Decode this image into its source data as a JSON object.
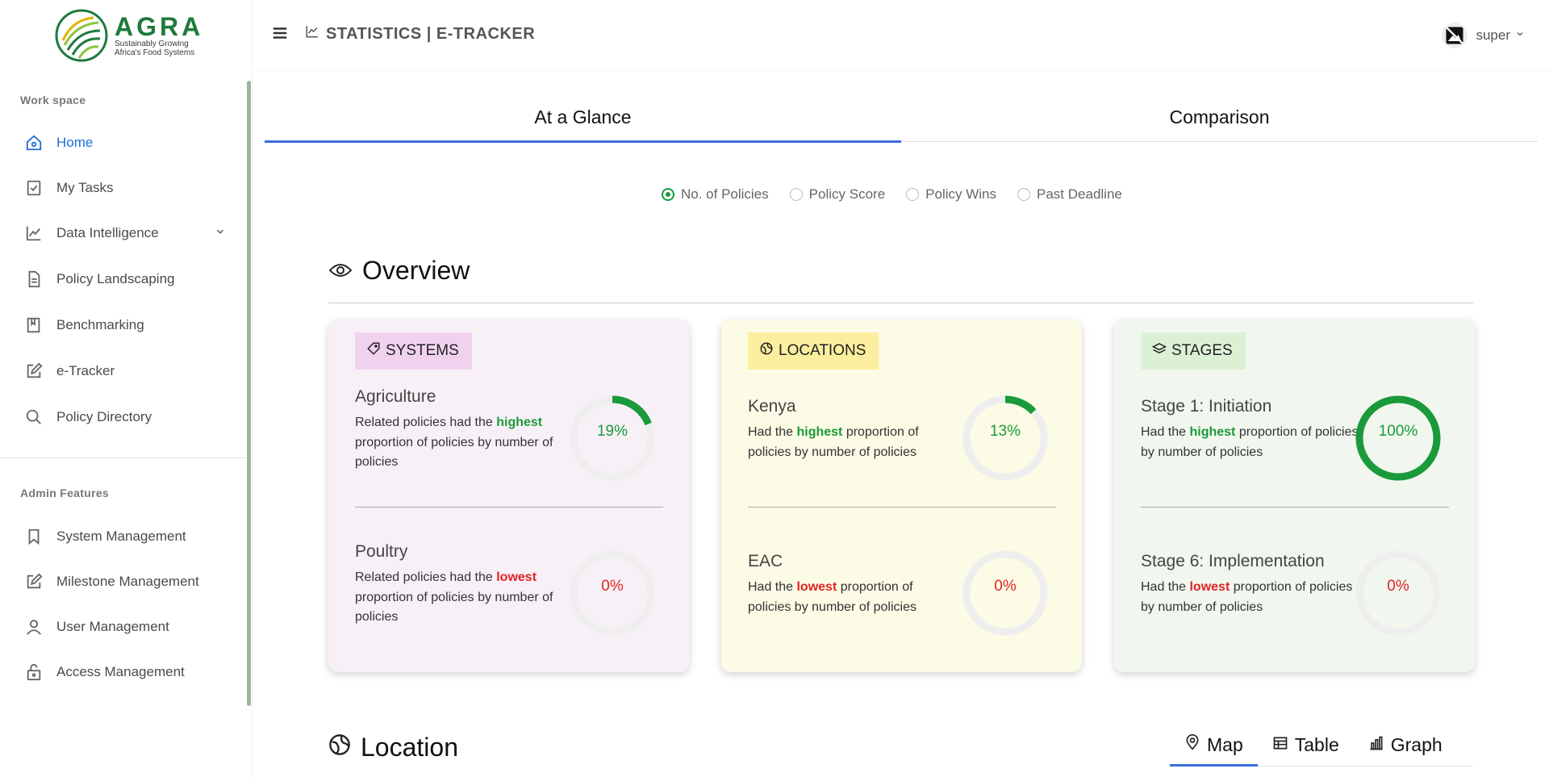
{
  "brand": {
    "name": "AGRA",
    "tagline_line1": "Sustainably Growing",
    "tagline_line2": "Africa's Food Systems",
    "color": "#1e7a3c"
  },
  "sidebar": {
    "workspace_title": "Work space",
    "workspace_items": [
      {
        "label": "Home",
        "icon": "home-icon",
        "active": true
      },
      {
        "label": "My Tasks",
        "icon": "clipboard-check-icon"
      },
      {
        "label": "Data Intelligence",
        "icon": "line-chart-icon",
        "expandable": true
      },
      {
        "label": "Policy Landscaping",
        "icon": "document-icon"
      },
      {
        "label": "Benchmarking",
        "icon": "book-icon"
      },
      {
        "label": "e-Tracker",
        "icon": "edit-icon"
      },
      {
        "label": "Policy Directory",
        "icon": "search-icon"
      }
    ],
    "admin_title": "Admin Features",
    "admin_items": [
      {
        "label": "System Management",
        "icon": "bookmark-icon"
      },
      {
        "label": "Milestone Management",
        "icon": "edit-icon"
      },
      {
        "label": "User Management",
        "icon": "user-icon"
      },
      {
        "label": "Access Management",
        "icon": "lock-icon"
      }
    ]
  },
  "header": {
    "title": "STATISTICS | E-TRACKER",
    "user_name": "super"
  },
  "tabs": [
    {
      "label": "At a Glance",
      "active": true
    },
    {
      "label": "Comparison",
      "active": false
    }
  ],
  "metric_options": [
    {
      "label": "No. of Policies",
      "checked": true
    },
    {
      "label": "Policy Score",
      "checked": false
    },
    {
      "label": "Policy Wins",
      "checked": false
    },
    {
      "label": "Past Deadline",
      "checked": false
    }
  ],
  "overview": {
    "title": "Overview",
    "cards": [
      {
        "badge": "SYSTEMS",
        "top": {
          "title": "Agriculture",
          "pre": "Related policies had the ",
          "keyword": "highest",
          "post": " proportion of policies by number of policies",
          "percent_label": "19%",
          "percent": 19
        },
        "bottom": {
          "title": "Poultry",
          "pre": "Related policies had the ",
          "keyword": "lowest",
          "post": " proportion of policies by number of policies",
          "percent_label": "0%",
          "percent": 0
        }
      },
      {
        "badge": "LOCATIONS",
        "top": {
          "title": "Kenya",
          "pre": "Had the ",
          "keyword": "highest",
          "post": " proportion of policies by number of policies",
          "percent_label": "13%",
          "percent": 13
        },
        "bottom": {
          "title": "EAC",
          "pre": "Had the ",
          "keyword": "lowest",
          "post": " proportion of policies by number of policies",
          "percent_label": "0%",
          "percent": 0
        }
      },
      {
        "badge": "STAGES",
        "top": {
          "title": "Stage 1: Initiation",
          "pre": "Had the ",
          "keyword": "highest",
          "post": " proportion of policies by number of policies",
          "percent_label": "100%",
          "percent": 100
        },
        "bottom": {
          "title": "Stage 6: Implementation",
          "pre": "Had the ",
          "keyword": "lowest",
          "post": " proportion of policies by number of policies",
          "percent_label": "0%",
          "percent": 0
        }
      }
    ]
  },
  "location": {
    "title": "Location",
    "views": [
      {
        "label": "Map",
        "icon": "map-pin-icon",
        "active": true
      },
      {
        "label": "Table",
        "icon": "table-icon",
        "active": false
      },
      {
        "label": "Graph",
        "icon": "bar-chart-icon",
        "active": false
      }
    ]
  },
  "colors": {
    "accent_blue": "#3a6fd8",
    "active_nav": "#1f6fd6",
    "highlight_green": "#1a9a3a",
    "lowlight_red": "#e02424",
    "ring_track": "#eeeeee"
  }
}
